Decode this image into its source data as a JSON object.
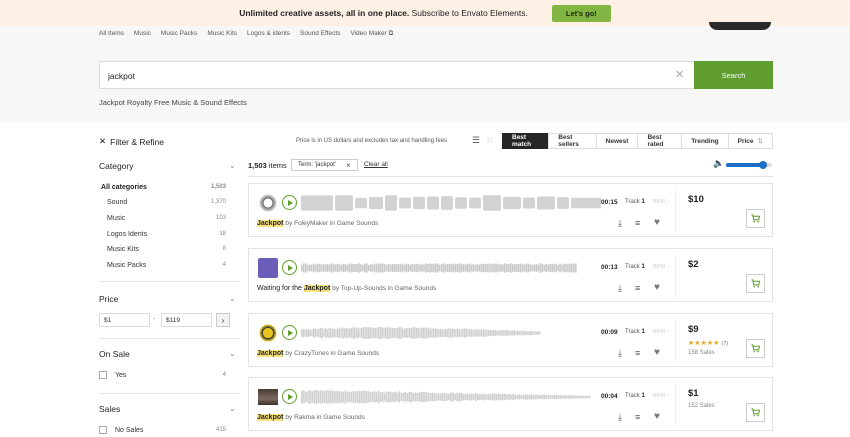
{
  "promo": {
    "text_bold": "Unlimited creative assets, all in one place.",
    "text_rest": " Subscribe to Envato Elements.",
    "cta": "Let's go!"
  },
  "nav": {
    "items": [
      "All Items",
      "Music",
      "Music Packs",
      "Music Kits",
      "Logos & idents",
      "Sound Effects",
      "Video Maker"
    ]
  },
  "search": {
    "value": "jackpot",
    "button": "Search",
    "clear_icon": "close-icon"
  },
  "page_heading": "Jackpot Royalty Free Music & Sound Effects",
  "sidebar": {
    "filter_label": "Filter & Refine",
    "category_title": "Category",
    "categories": [
      {
        "label": "All categories",
        "count": "1,503"
      },
      {
        "label": "Sound",
        "count": "1,370"
      },
      {
        "label": "Music",
        "count": "103"
      },
      {
        "label": "Logos Idents",
        "count": "18"
      },
      {
        "label": "Music Kits",
        "count": "8"
      },
      {
        "label": "Music Packs",
        "count": "4"
      }
    ],
    "price_title": "Price",
    "price_min": "$1",
    "price_sep": "-",
    "price_max": "$119",
    "price_go": "›",
    "onsale_title": "On Sale",
    "onsale_yes": "Yes",
    "onsale_count": "4",
    "sales_title": "Sales",
    "nosales_label": "No Sales",
    "nosales_count": "415"
  },
  "toolbar": {
    "price_note": "Price is in US dollars and excludes tax and handling fees",
    "sort_tabs": [
      "Best match",
      "Best sellers",
      "Newest",
      "Best rated",
      "Trending",
      "Price"
    ],
    "active_sort": "Best match"
  },
  "results": {
    "count": "1,503",
    "count_suffix": " items",
    "term_chip": "Term: 'jackpot'",
    "chip_close": "×",
    "clear_all": "Clear all",
    "volume_level": 0.8
  },
  "items": [
    {
      "title_prefix": "",
      "title_highlight": "Jackpot",
      "title_suffix": "",
      "by": "by FoleyMaker in Game Sounds",
      "duration": "00:15",
      "track_label": "Track",
      "track_num": "1",
      "bpm": "BPM --",
      "price": "$10",
      "rating": "",
      "reviews": "",
      "sales": ""
    },
    {
      "title_prefix": "Waiting for the ",
      "title_highlight": "Jackpot",
      "title_suffix": "",
      "by": "by Top-Up-Sounds in Game Sounds",
      "duration": "00:13",
      "track_label": "Track",
      "track_num": "1",
      "bpm": "BPM --",
      "price": "$2",
      "rating": "",
      "reviews": "",
      "sales": ""
    },
    {
      "title_prefix": "",
      "title_highlight": "Jackpot",
      "title_suffix": "",
      "by": "by CrazyTunes in Game Sounds",
      "duration": "00:09",
      "track_label": "Track",
      "track_num": "1",
      "bpm": "BPM --",
      "price": "$9",
      "rating": "★★★★★",
      "reviews": "(7)",
      "sales": "158 Sales"
    },
    {
      "title_prefix": "",
      "title_highlight": "Jackpot",
      "title_suffix": "",
      "by": "by Rakma in Game Sounds",
      "duration": "00:04",
      "track_label": "Track",
      "track_num": "1",
      "bpm": "BPM --",
      "price": "$1",
      "rating": "",
      "reviews": "",
      "sales": "152 Sales"
    }
  ],
  "colors": {
    "accent_green": "#5f9e2e",
    "promo_bg": "#fdf1e6",
    "highlight": "#f7e17b",
    "volume": "#1d6fc6"
  }
}
